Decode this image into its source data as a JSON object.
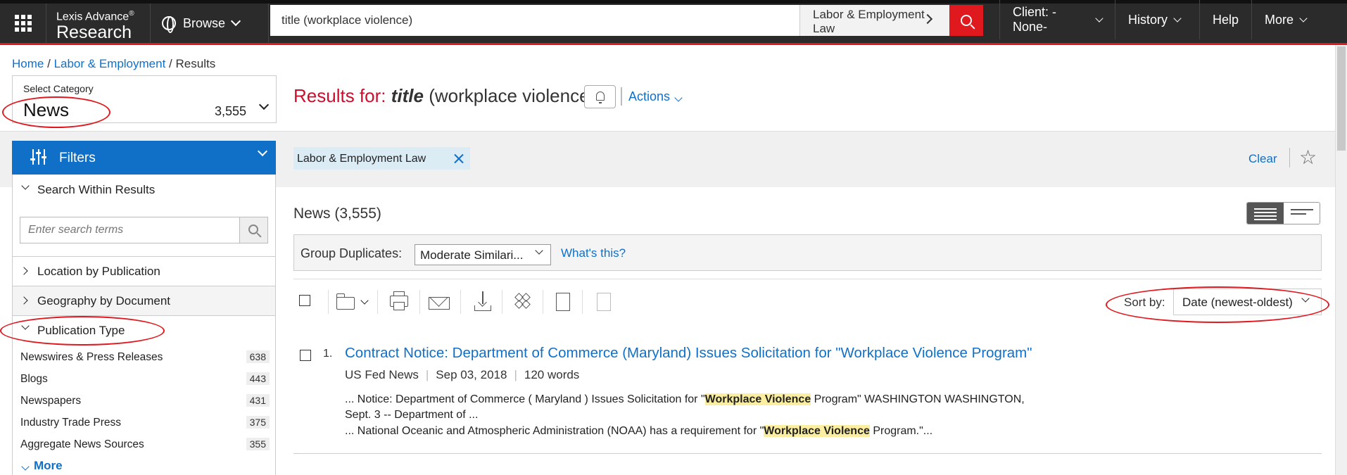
{
  "topbar": {
    "logo_line1": "Lexis Advance",
    "logo_reg": "®",
    "logo_line2": "Research",
    "browse_label": "Browse",
    "search_value": "title (workplace violence)",
    "search_scope": "Labor & Employment Law",
    "client_label": "Client: -None-",
    "history_label": "History",
    "help_label": "Help",
    "more_label": "More"
  },
  "breadcrumb": {
    "home": "Home",
    "sep1": "/",
    "section": "Labor & Employment",
    "sep2": "/",
    "current": "Results"
  },
  "category": {
    "label": "Select Category",
    "value": "News",
    "count": "3,555"
  },
  "results_header": {
    "prefix": "Results for:",
    "term_italic": "title",
    "term_rest": "(workplace violence)",
    "actions_label": "Actions"
  },
  "filters": {
    "title": "Filters",
    "search_within": "Search Within Results",
    "search_placeholder": "Enter search terms",
    "location": "Location by Publication",
    "geography": "Geography by Document",
    "pub_type": "Publication Type",
    "pub_items": [
      {
        "label": "Newswires & Press Releases",
        "count": "638"
      },
      {
        "label": "Blogs",
        "count": "443"
      },
      {
        "label": "Newspapers",
        "count": "431"
      },
      {
        "label": "Industry Trade Press",
        "count": "375"
      },
      {
        "label": "Aggregate News Sources",
        "count": "355"
      }
    ],
    "more_label": "More"
  },
  "active_filter": {
    "tag": "Labor & Employment Law",
    "clear_label": "Clear"
  },
  "results": {
    "heading": "News (3,555)",
    "group_label": "Group Duplicates:",
    "group_value": "Moderate Similari...",
    "whats_this": "What's this?",
    "sort_label": "Sort by:",
    "sort_value": "Date (newest-oldest)",
    "items": [
      {
        "num": "1.",
        "title": "Contract Notice: Department of Commerce (Maryland) Issues Solicitation for \"Workplace Violence Program\"",
        "source": "US Fed News",
        "date": "Sep 03, 2018",
        "words": "120 words",
        "snip1_a": "... Notice: Department of Commerce ( Maryland ) Issues Solicitation for \"",
        "snip1_hl": "Workplace Violence",
        "snip1_b": " Program\" WASHINGTON WASHINGTON,",
        "snip2": "Sept. 3 -- Department of ...",
        "snip3_a": "... National Oceanic and Atmospheric Administration (NOAA) has a requirement for \"",
        "snip3_hl": "Workplace Violence",
        "snip3_b": " Program.\"..."
      }
    ]
  },
  "colors": {
    "brand_red": "#e0191f",
    "link_blue": "#1070c8",
    "title_red": "#c8102e",
    "highlight": "#fbeea0"
  }
}
